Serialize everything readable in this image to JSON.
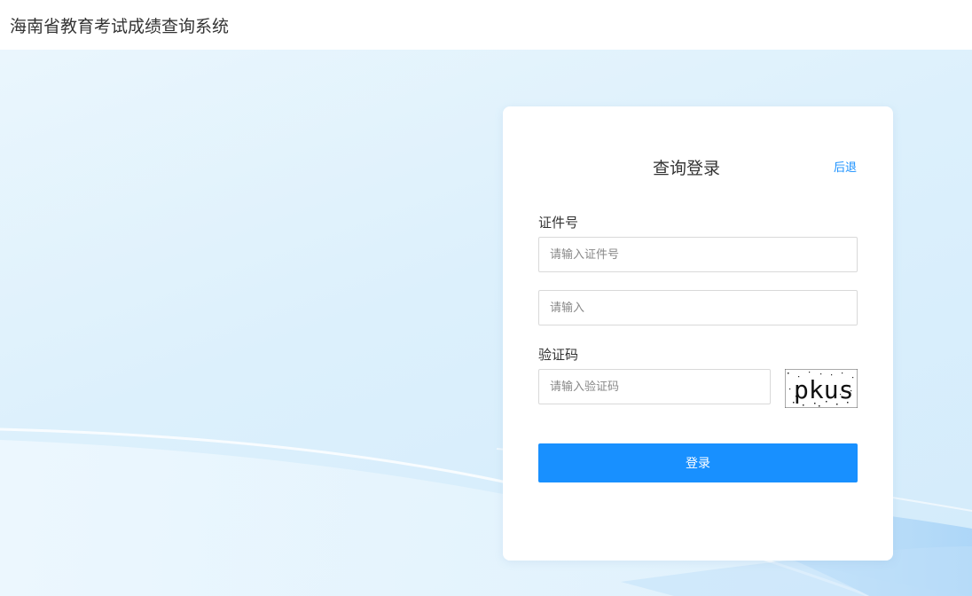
{
  "header": {
    "title": "海南省教育考试成绩查询系统"
  },
  "login": {
    "title": "查询登录",
    "back_label": "后退",
    "id_label": "证件号",
    "id_placeholder": "请输入证件号",
    "second_placeholder": "请输入",
    "captcha_label": "验证码",
    "captcha_placeholder": "请输入验证码",
    "captcha_text": "pkus",
    "submit_label": "登录"
  },
  "colors": {
    "accent": "#1890ff",
    "background": "#dcf0fc",
    "card": "#ffffff"
  },
  "icons": {
    "captcha": "captcha-image"
  }
}
